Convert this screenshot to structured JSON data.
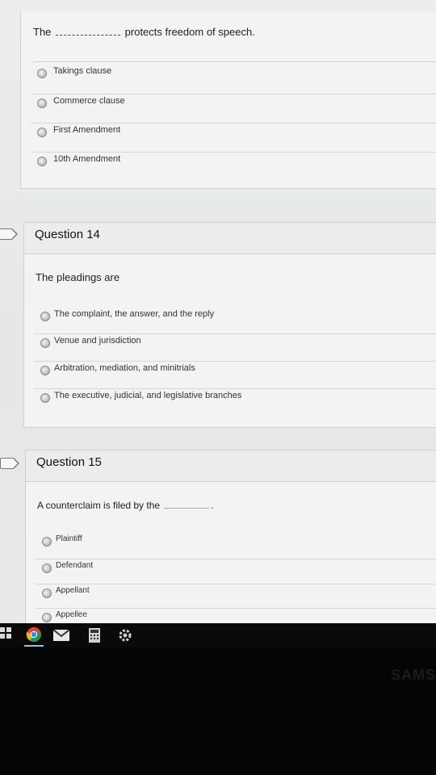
{
  "question13": {
    "prompt_prefix": "The",
    "prompt_suffix": "protects freedom of speech.",
    "options": [
      "Takings clause",
      "Commerce clause",
      "First Amendment",
      "10th Amendment"
    ]
  },
  "question14": {
    "title": "Question 14",
    "prompt": "The pleadings are",
    "options": [
      "The complaint, the answer, and the reply",
      "Venue and jurisdiction",
      "Arbitration, mediation, and minitrials",
      "The executive, judicial, and legislative branches"
    ]
  },
  "question15": {
    "title": "Question 15",
    "prompt": "A counterclaim is filed by the",
    "prompt_end": ".",
    "options": [
      "Plaintiff",
      "Defendant",
      "Appellant",
      "Appellee"
    ]
  },
  "monitor": {
    "brand": "SAMS"
  },
  "taskbar": {
    "icons": [
      "apps-icon",
      "chrome-icon",
      "mail-icon",
      "calculator-icon",
      "gear-icon"
    ]
  }
}
